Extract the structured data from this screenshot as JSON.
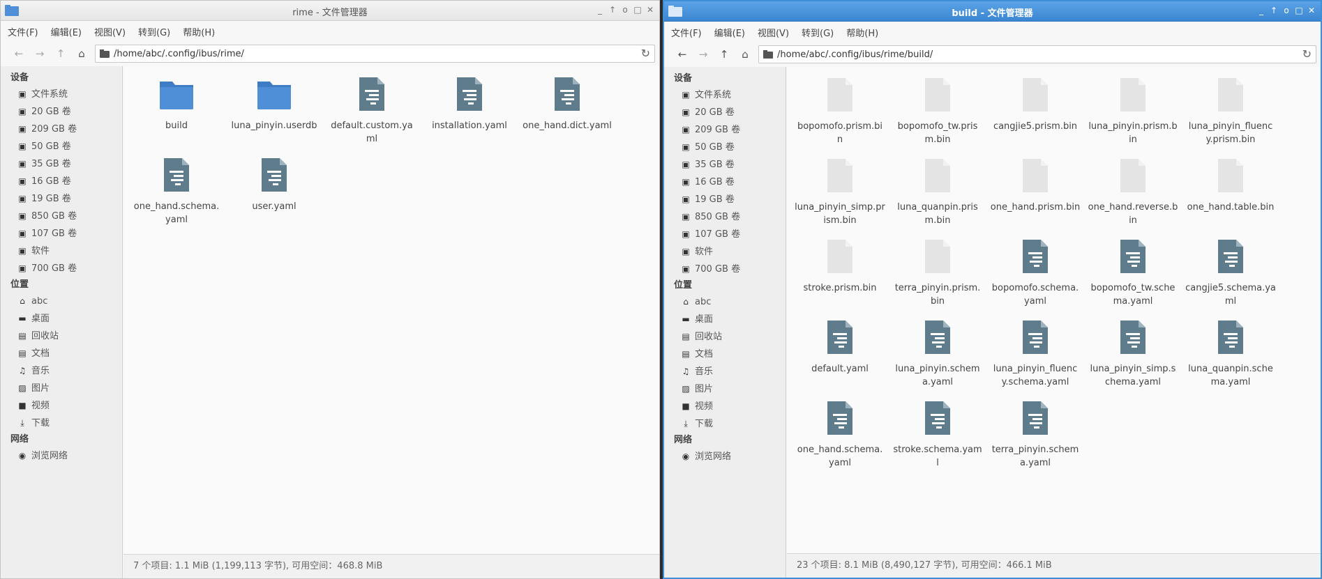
{
  "menu": [
    "文件(F)",
    "编辑(E)",
    "视图(V)",
    "转到(G)",
    "帮助(H)"
  ],
  "sidebar": {
    "devices_title": "设备",
    "devices": [
      "文件系统",
      "20 GB 卷",
      "209 GB 卷",
      "50 GB 卷",
      "35 GB 卷",
      "16 GB 卷",
      "19 GB 卷",
      "850 GB 卷",
      "107 GB 卷",
      "软件",
      "700 GB 卷"
    ],
    "places_title": "位置",
    "places": [
      {
        "label": "abc",
        "icon": "home-icon"
      },
      {
        "label": "桌面",
        "icon": "desktop-icon"
      },
      {
        "label": "回收站",
        "icon": "trash-icon"
      },
      {
        "label": "文档",
        "icon": "documents-icon"
      },
      {
        "label": "音乐",
        "icon": "music-icon"
      },
      {
        "label": "图片",
        "icon": "pictures-icon"
      },
      {
        "label": "视频",
        "icon": "videos-icon"
      },
      {
        "label": "下载",
        "icon": "downloads-icon"
      }
    ],
    "network_title": "网络",
    "network": [
      "浏览网络"
    ]
  },
  "left_window": {
    "title": "rime - 文件管理器",
    "path": "/home/abc/.config/ibus/rime/",
    "files": [
      {
        "name": "build",
        "type": "folder"
      },
      {
        "name": "luna_pinyin.userdb",
        "type": "folder"
      },
      {
        "name": "default.custom.yaml",
        "type": "text"
      },
      {
        "name": "installation.yaml",
        "type": "text"
      },
      {
        "name": "one_hand.dict.yaml",
        "type": "text"
      },
      {
        "name": "one_hand.schema.yaml",
        "type": "text"
      },
      {
        "name": "user.yaml",
        "type": "text"
      }
    ],
    "status": "7 个项目: 1.1 MiB (1,199,113 字节), 可用空间：468.8 MiB"
  },
  "right_window": {
    "title": "build - 文件管理器",
    "path": "/home/abc/.config/ibus/rime/build/",
    "files": [
      {
        "name": "bopomofo.prism.bin",
        "type": "binary"
      },
      {
        "name": "bopomofo_tw.prism.bin",
        "type": "binary"
      },
      {
        "name": "cangjie5.prism.bin",
        "type": "binary"
      },
      {
        "name": "luna_pinyin.prism.bin",
        "type": "binary"
      },
      {
        "name": "luna_pinyin_fluency.prism.bin",
        "type": "binary"
      },
      {
        "name": "luna_pinyin_simp.prism.bin",
        "type": "binary"
      },
      {
        "name": "luna_quanpin.prism.bin",
        "type": "binary"
      },
      {
        "name": "one_hand.prism.bin",
        "type": "binary"
      },
      {
        "name": "one_hand.reverse.bin",
        "type": "binary"
      },
      {
        "name": "one_hand.table.bin",
        "type": "binary"
      },
      {
        "name": "stroke.prism.bin",
        "type": "binary"
      },
      {
        "name": "terra_pinyin.prism.bin",
        "type": "binary"
      },
      {
        "name": "bopomofo.schema.yaml",
        "type": "text"
      },
      {
        "name": "bopomofo_tw.schema.yaml",
        "type": "text"
      },
      {
        "name": "cangjie5.schema.yaml",
        "type": "text"
      },
      {
        "name": "default.yaml",
        "type": "text"
      },
      {
        "name": "luna_pinyin.schema.yaml",
        "type": "text"
      },
      {
        "name": "luna_pinyin_fluency.schema.yaml",
        "type": "text"
      },
      {
        "name": "luna_pinyin_simp.schema.yaml",
        "type": "text"
      },
      {
        "name": "luna_quanpin.schema.yaml",
        "type": "text"
      },
      {
        "name": "one_hand.schema.yaml",
        "type": "text"
      },
      {
        "name": "stroke.schema.yaml",
        "type": "text"
      },
      {
        "name": "terra_pinyin.schema.yaml",
        "type": "text"
      }
    ],
    "status": "23 个项目: 8.1 MiB (8,490,127 字节), 可用空间：466.1 MiB"
  },
  "colors": {
    "folder": "#4f8fd8",
    "text_file": "#5f7c8c",
    "binary_file": "#e4e4e4",
    "active_title": "#3d8fd8"
  }
}
